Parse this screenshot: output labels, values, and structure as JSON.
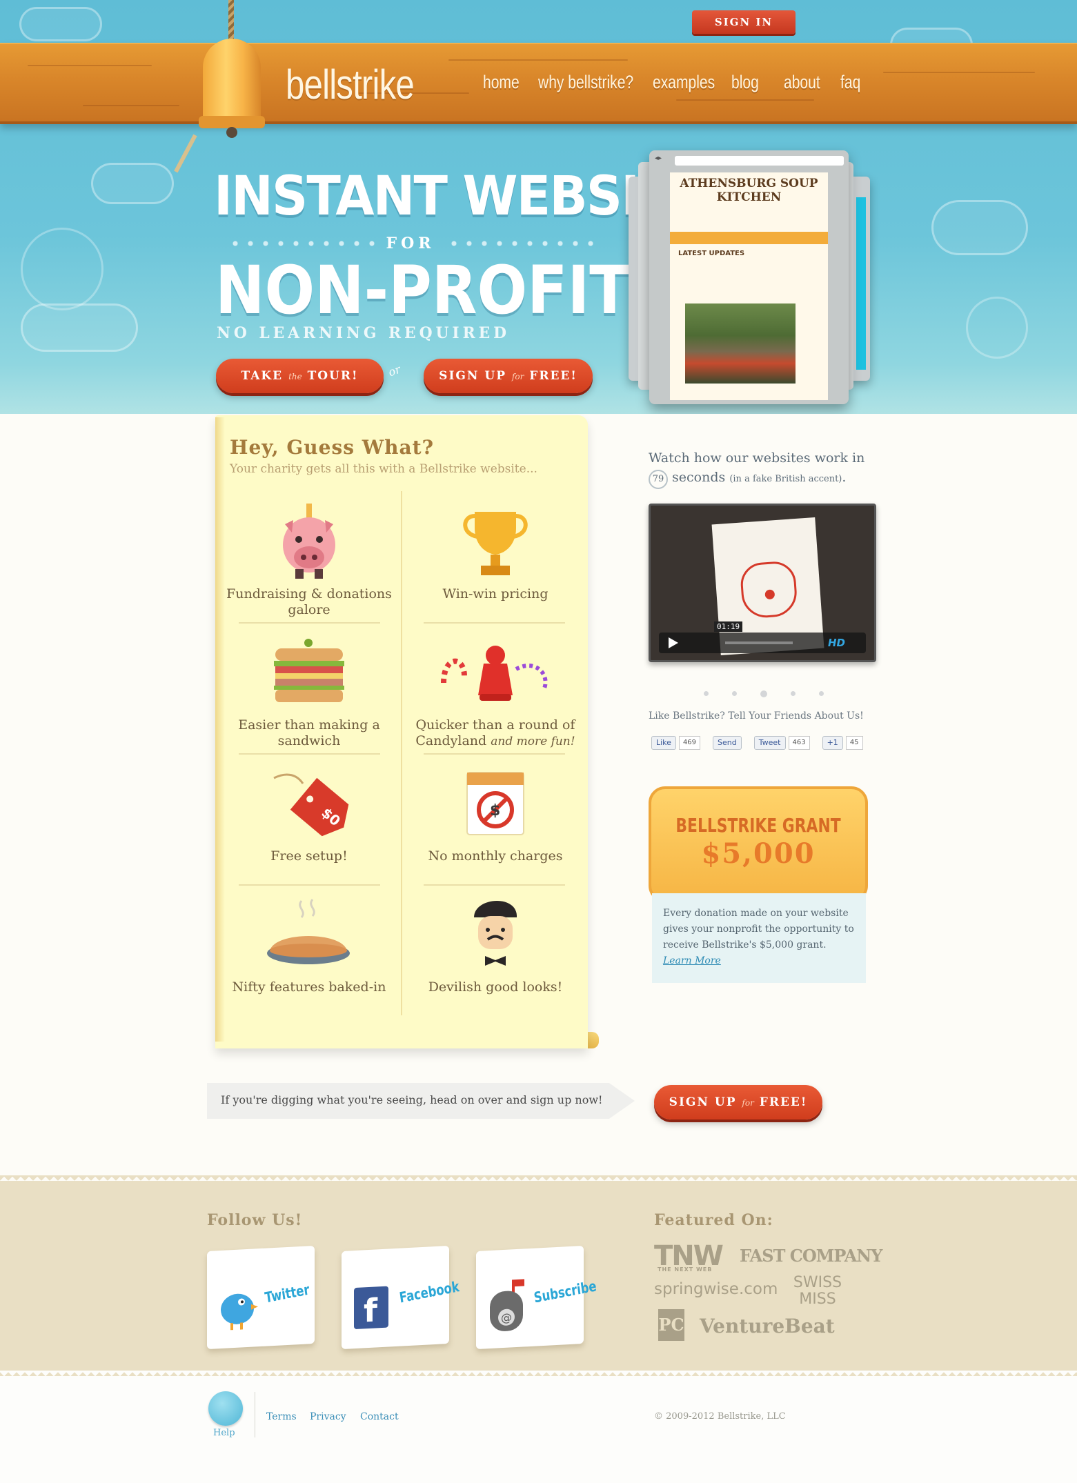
{
  "header": {
    "logo": "bellstrike",
    "nav": [
      "home",
      "why bellstrike?",
      "examples",
      "blog",
      "about",
      "faq"
    ],
    "signin_label": "SIGN IN"
  },
  "hero": {
    "line1": "INSTANT WEBSITES",
    "line_for": "FOR",
    "line2": "NON-PROFITS",
    "line3": "NO LEARNING REQUIRED",
    "tour_btn": {
      "pre": "TAKE",
      "mid": "the",
      "post": "TOUR!"
    },
    "or": "or",
    "signup_btn": {
      "pre": "SIGN UP",
      "mid": "for",
      "post": "FREE!"
    },
    "preview": {
      "site_title": "ATHENSBURG SOUP KITCHEN",
      "updates_heading": "LATEST UPDATES"
    }
  },
  "features": {
    "title": "Hey, Guess What?",
    "subtitle": "Your charity gets all this with a Bellstrike website...",
    "items": [
      {
        "icon": "piggy-bank-icon",
        "label": "Fundraising & donations galore"
      },
      {
        "icon": "trophy-icon",
        "label": "Win-win pricing"
      },
      {
        "icon": "sandwich-icon",
        "label": "Easier than making a sandwich"
      },
      {
        "icon": "candy-icon",
        "label": "Quicker than a round of Candyland",
        "extra": "and more fun!"
      },
      {
        "icon": "price-tag-icon",
        "label": "Free setup!"
      },
      {
        "icon": "no-dollar-calendar-icon",
        "label": "No monthly charges"
      },
      {
        "icon": "pie-icon",
        "label": "Nifty features baked-in"
      },
      {
        "icon": "dapper-man-icon",
        "label": "Devilish good looks!"
      }
    ]
  },
  "video": {
    "intro": "Watch how our websites work in",
    "seconds": "79",
    "seconds_label": "seconds",
    "note": "(in a fake British accent)",
    "time": "01:19",
    "hd": "HD"
  },
  "social": {
    "prompt": "Like Bellstrike? Tell Your Friends About Us!",
    "like": "Like",
    "like_count": "469",
    "send": "Send",
    "tweet": "Tweet",
    "tweet_count": "463",
    "plus": "+1",
    "plus_count": "45"
  },
  "grant": {
    "title": "BELLSTRIKE GRANT",
    "amount": "$5,000",
    "text": "Every donation made on your website gives your nonprofit the opportunity to receive Bellstrike's $5,000 grant.",
    "link": "Learn More"
  },
  "cta": {
    "text": "If you're digging what you're seeing, head on over and sign up now!",
    "button": {
      "pre": "SIGN UP",
      "mid": "for",
      "post": "FREE!"
    }
  },
  "footer": {
    "follow_title": "Follow Us!",
    "follow_cards": [
      "Twitter",
      "Facebook",
      "Subscribe"
    ],
    "featured_title": "Featured On:",
    "press": [
      "TNW",
      "THE NEXT WEB",
      "FAST COMPANY",
      "springwise.com",
      "SWISS MISS",
      "PC",
      "VentureBeat"
    ],
    "help": "Help",
    "links": [
      "Terms",
      "Privacy",
      "Contact"
    ],
    "copyright": "© 2009-2012 Bellstrike, LLC"
  },
  "colors": {
    "sky": "#6cc5da",
    "wood": "#d9862a",
    "accent_red": "#d03d1d",
    "scroll": "#fefbc7",
    "footer": "#e9dfc4"
  }
}
